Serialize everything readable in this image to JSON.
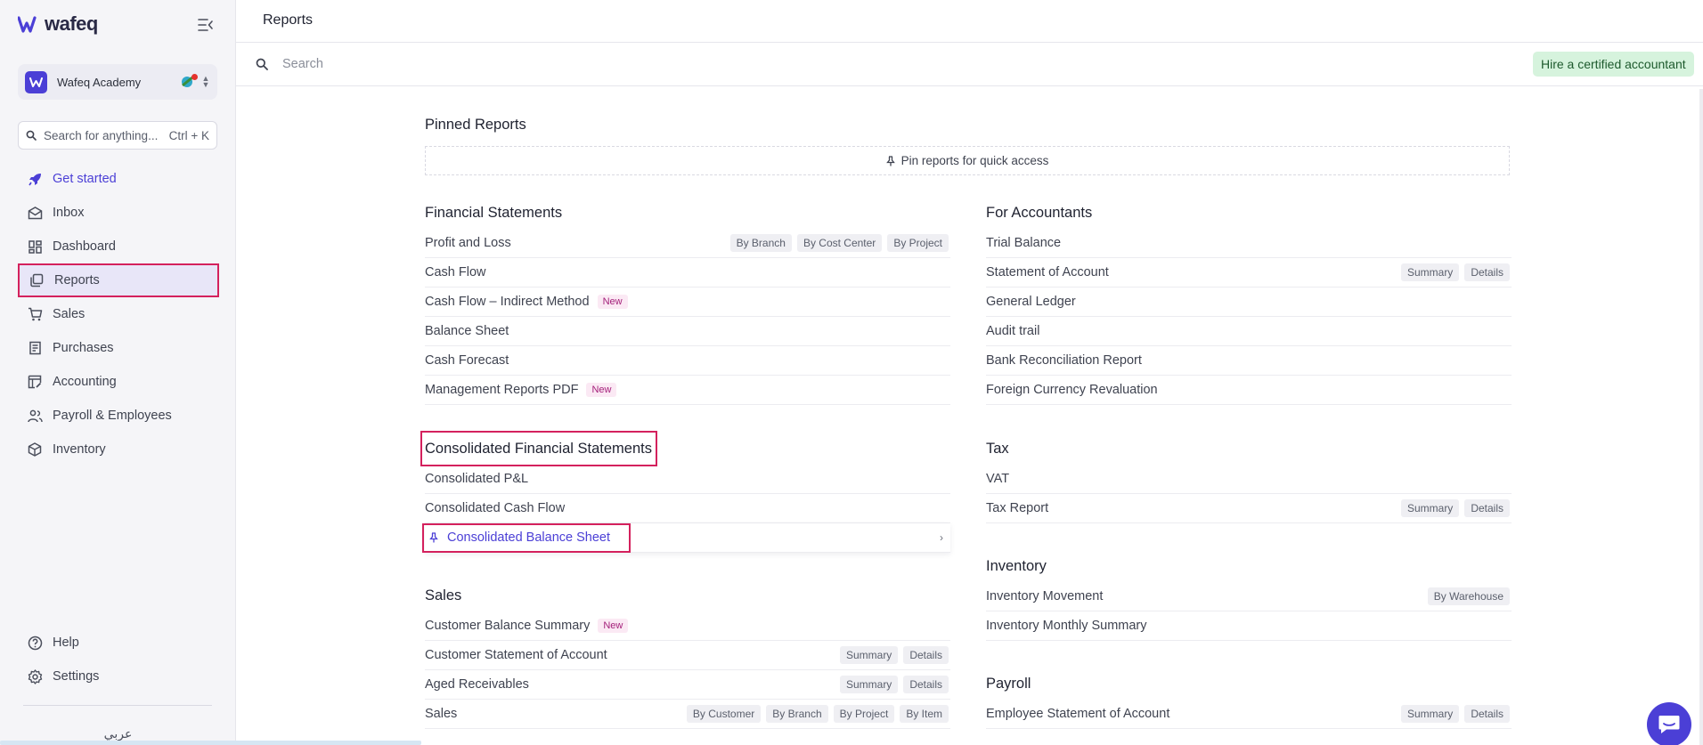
{
  "app": {
    "brand": "wafeq",
    "accent": "#4b3fd6",
    "highlight": "#d4215d"
  },
  "sidebar": {
    "org_name": "Wafeq Academy",
    "search_placeholder": "Search for anything...",
    "search_shortcut": "Ctrl + K",
    "items": [
      {
        "label": "Get started",
        "icon": "rocket-icon"
      },
      {
        "label": "Inbox",
        "icon": "envelope-icon"
      },
      {
        "label": "Dashboard",
        "icon": "grid-icon"
      },
      {
        "label": "Reports",
        "icon": "reports-icon"
      },
      {
        "label": "Sales",
        "icon": "cart-icon"
      },
      {
        "label": "Purchases",
        "icon": "receipt-icon"
      },
      {
        "label": "Accounting",
        "icon": "ledger-icon"
      },
      {
        "label": "Payroll & Employees",
        "icon": "people-icon"
      },
      {
        "label": "Inventory",
        "icon": "box-icon"
      }
    ],
    "bottom_items": [
      {
        "label": "Help",
        "icon": "help-icon"
      },
      {
        "label": "Settings",
        "icon": "gear-icon"
      }
    ],
    "language": "عربي"
  },
  "header": {
    "title": "Reports"
  },
  "search": {
    "placeholder": "Search"
  },
  "hire_button": "Hire a certified accountant",
  "pinned": {
    "title": "Pinned Reports",
    "empty_text": "Pin reports for quick access"
  },
  "left_sections": [
    {
      "title": "Financial Statements",
      "rows": [
        {
          "name": "Profit and Loss",
          "tags": [
            "By Branch",
            "By Cost Center",
            "By Project"
          ]
        },
        {
          "name": "Cash Flow"
        },
        {
          "name": "Cash Flow – Indirect Method",
          "badge": "New"
        },
        {
          "name": "Balance Sheet"
        },
        {
          "name": "Cash Forecast"
        },
        {
          "name": "Management Reports PDF",
          "badge": "New"
        }
      ]
    },
    {
      "title": "Consolidated Financial Statements",
      "rows": [
        {
          "name": "Consolidated P&L"
        },
        {
          "name": "Consolidated Cash Flow"
        },
        {
          "name": "Consolidated Balance Sheet",
          "hover": true
        }
      ]
    },
    {
      "title": "Sales",
      "rows": [
        {
          "name": "Customer Balance Summary",
          "badge": "New"
        },
        {
          "name": "Customer Statement of Account",
          "tags": [
            "Summary",
            "Details"
          ]
        },
        {
          "name": "Aged Receivables",
          "tags": [
            "Summary",
            "Details"
          ]
        },
        {
          "name": "Sales",
          "tags": [
            "By Customer",
            "By Branch",
            "By Project",
            "By Item"
          ]
        }
      ]
    }
  ],
  "right_sections": [
    {
      "title": "For Accountants",
      "rows": [
        {
          "name": "Trial Balance"
        },
        {
          "name": "Statement of Account",
          "tags": [
            "Summary",
            "Details"
          ]
        },
        {
          "name": "General Ledger"
        },
        {
          "name": "Audit trail"
        },
        {
          "name": "Bank Reconciliation Report"
        },
        {
          "name": "Foreign Currency Revaluation"
        }
      ]
    },
    {
      "title": "Tax",
      "rows": [
        {
          "name": "VAT"
        },
        {
          "name": "Tax Report",
          "tags": [
            "Summary",
            "Details"
          ]
        }
      ]
    },
    {
      "title": "Inventory",
      "rows": [
        {
          "name": "Inventory Movement",
          "tags": [
            "By Warehouse"
          ]
        },
        {
          "name": "Inventory Monthly Summary"
        }
      ]
    },
    {
      "title": "Payroll",
      "rows": [
        {
          "name": "Employee Statement of Account",
          "tags": [
            "Summary",
            "Details"
          ]
        }
      ]
    }
  ]
}
